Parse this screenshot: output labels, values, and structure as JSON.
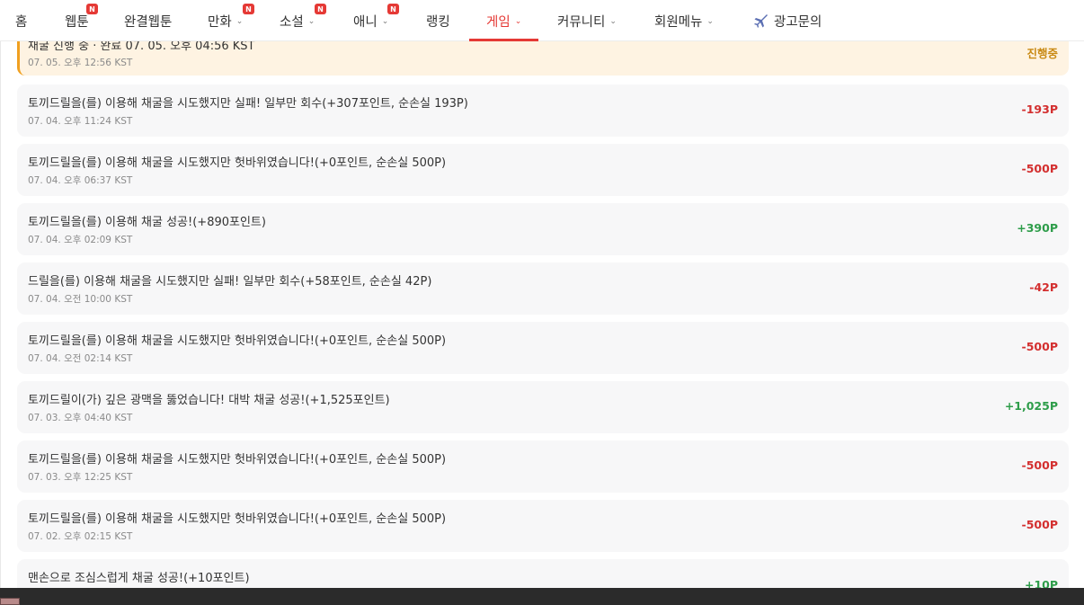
{
  "nav": {
    "items": [
      {
        "label": "홈"
      },
      {
        "label": "웹툰",
        "badge": "N"
      },
      {
        "label": "완결웹툰"
      },
      {
        "label": "만화",
        "badge": "N"
      },
      {
        "label": "소설",
        "badge": "N"
      },
      {
        "label": "애니",
        "badge": "N"
      },
      {
        "label": "랭킹"
      },
      {
        "label": "게임",
        "active": true
      },
      {
        "label": "커뮤니티"
      },
      {
        "label": "회원메뉴"
      },
      {
        "label": "광고문의",
        "icon": "airplane-icon"
      }
    ]
  },
  "records": [
    {
      "message": "채굴 진행 중 · 완료 07. 05. 오후 04:56 KST",
      "time": "07. 05. 오후 12:56 KST",
      "amount": "진행중",
      "type": "status"
    },
    {
      "message": "토끼드릴을(를) 이용해 채굴을 시도했지만 실패! 일부만 회수(+307포인트, 순손실 193P)",
      "time": "07. 04. 오후 11:24 KST",
      "amount": "-193P",
      "type": "negative"
    },
    {
      "message": "토끼드릴을(를) 이용해 채굴을 시도했지만 헛바위였습니다!(+0포인트, 순손실 500P)",
      "time": "07. 04. 오후 06:37 KST",
      "amount": "-500P",
      "type": "negative"
    },
    {
      "message": "토끼드릴을(를) 이용해 채굴 성공!(+890포인트)",
      "time": "07. 04. 오후 02:09 KST",
      "amount": "+390P",
      "type": "positive"
    },
    {
      "message": "드릴을(를) 이용해 채굴을 시도했지만 실패! 일부만 회수(+58포인트, 순손실 42P)",
      "time": "07. 04. 오전 10:00 KST",
      "amount": "-42P",
      "type": "negative"
    },
    {
      "message": "토끼드릴을(를) 이용해 채굴을 시도했지만 헛바위였습니다!(+0포인트, 순손실 500P)",
      "time": "07. 04. 오전 02:14 KST",
      "amount": "-500P",
      "type": "negative"
    },
    {
      "message": "토끼드릴이(가) 깊은 광맥을 뚫었습니다! 대박 채굴 성공!(+1,525포인트)",
      "time": "07. 03. 오후 04:40 KST",
      "amount": "+1,025P",
      "type": "positive"
    },
    {
      "message": "토끼드릴을(를) 이용해 채굴을 시도했지만 헛바위였습니다!(+0포인트, 순손실 500P)",
      "time": "07. 03. 오후 12:25 KST",
      "amount": "-500P",
      "type": "negative"
    },
    {
      "message": "토끼드릴을(를) 이용해 채굴을 시도했지만 헛바위였습니다!(+0포인트, 순손실 500P)",
      "time": "07. 02. 오후 02:15 KST",
      "amount": "-500P",
      "type": "negative"
    },
    {
      "message": "맨손으로 조심스럽게 채굴 성공!(+10포인트)",
      "time": "",
      "amount": "+10P",
      "type": "positive"
    }
  ],
  "colors": {
    "accent": "#e53935",
    "negative": "#d32f2f",
    "positive": "#2e9d4a",
    "status": "#c98a14",
    "active_card_bg": "#fef3e2",
    "active_card_border": "#f0a020"
  }
}
